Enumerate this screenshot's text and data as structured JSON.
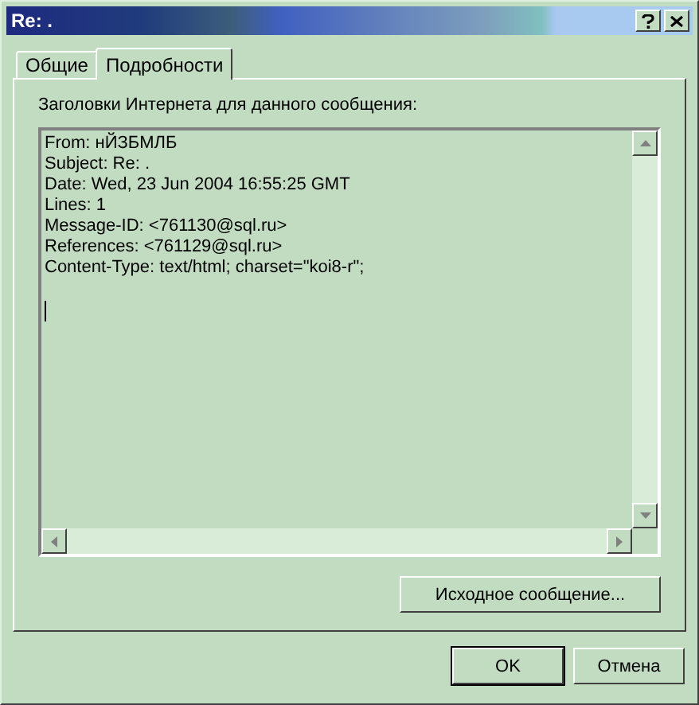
{
  "window": {
    "title": "Re: ."
  },
  "tabs": [
    {
      "label": "Общие",
      "selected": false
    },
    {
      "label": "Подробности",
      "selected": true
    }
  ],
  "details": {
    "label": "Заголовки Интернета для данного сообщения:",
    "header_lines": [
      "From: нЙЗБМЛБ",
      "Subject: Re: .",
      "Date: Wed, 23 Jun 2004 16:55:25 GMT",
      "Lines: 1",
      "Message-ID: <761130@sql.ru>",
      "References: <761129@sql.ru>",
      "Content-Type: text/html; charset=\"koi8-r\";"
    ],
    "source_button": "Исходное сообщение..."
  },
  "buttons": [
    {
      "label": "OK",
      "default": true
    },
    {
      "label": "Отмена",
      "default": false
    }
  ]
}
